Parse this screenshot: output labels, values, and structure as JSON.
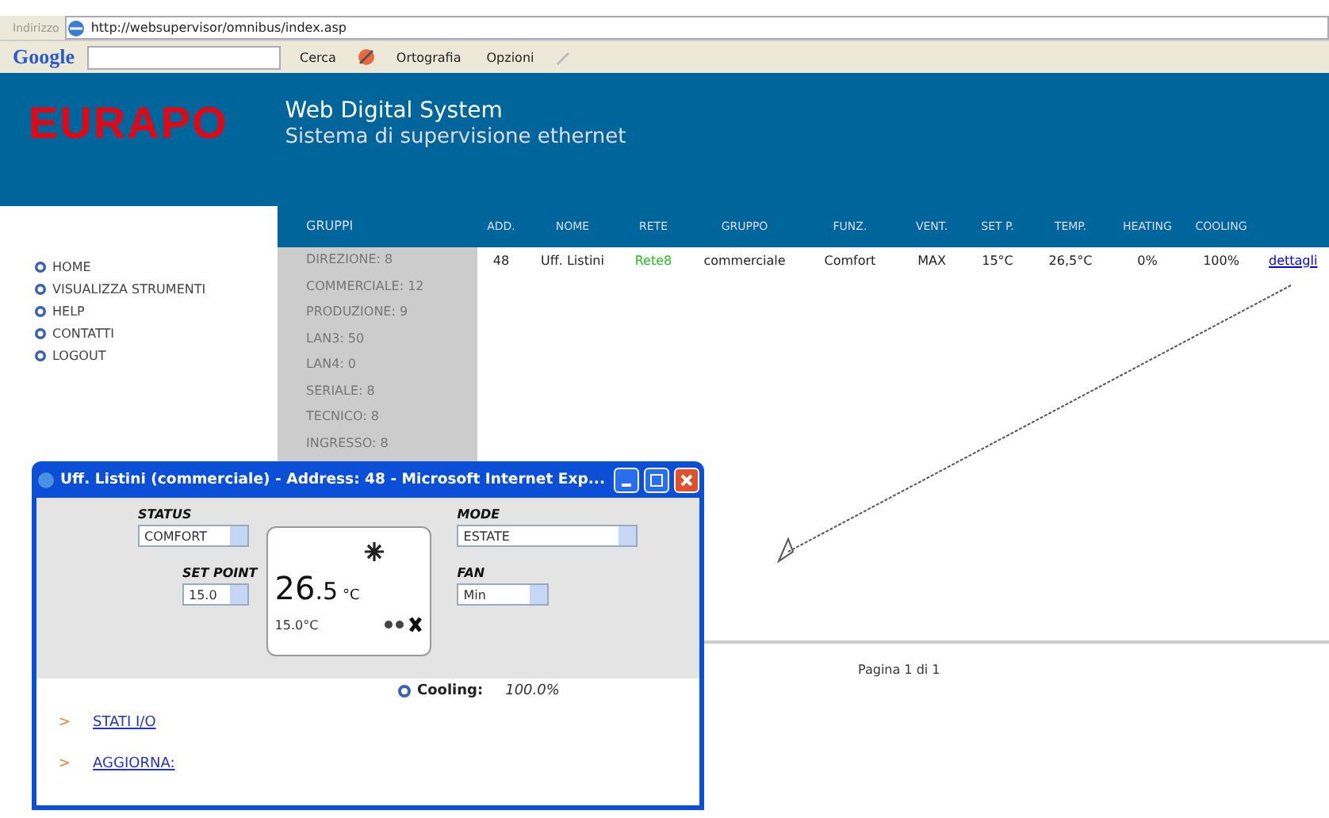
{
  "browser": {
    "address_label": "Indirizzo",
    "url": "http://websupervisor/omnibus/index.asp",
    "google": "Google",
    "search_button": "Cerca",
    "spell_button": "Ortografia",
    "options_button": "Opzioni"
  },
  "header": {
    "logo": "EURAPO",
    "title": "Web Digital System",
    "subtitle": "Sistema di supervisione ethernet"
  },
  "nav": [
    "HOME",
    "VISUALIZZA STRUMENTI",
    "HELP",
    "CONTATTI",
    "LOGOUT"
  ],
  "groups": {
    "heading": "GRUPPI",
    "items": [
      "DIREZIONE: 8",
      "COMMERCIALE: 12",
      "PRODUZIONE: 9",
      "LAN3: 50",
      "LAN4: 0",
      "SERIALE: 8",
      "TECNICO: 8",
      "INGRESSO: 8"
    ]
  },
  "table": {
    "columns": [
      "ADD.",
      "NOME",
      "RETE",
      "GRUPPO",
      "FUNZ.",
      "VENT.",
      "SET P.",
      "TEMP.",
      "HEATING",
      "COOLING"
    ],
    "rows": [
      {
        "add": "48",
        "nome": "Uff. Listini",
        "rete": "Rete8",
        "gruppo": "commerciale",
        "funz": "Comfort",
        "vent": "MAX",
        "setp": "15°C",
        "temp": "26,5°C",
        "heating": "0%",
        "cooling": "100%",
        "link": "dettagli"
      }
    ]
  },
  "pagination": "Pagina 1 di 1",
  "popup": {
    "title": "Uff. Listini (commerciale) - Address: 48 - Microsoft Internet Exp...",
    "status": {
      "label": "STATUS",
      "value": "COMFORT"
    },
    "mode": {
      "label": "MODE",
      "value": "ESTATE"
    },
    "set_point": {
      "label": "SET POINT",
      "value": "15.0"
    },
    "fan": {
      "label": "FAN",
      "value": "Min"
    },
    "display": {
      "temp_int": "26",
      "temp_dec": ".5",
      "unit": "°C",
      "setpoint": "15.0°C"
    },
    "cooling": {
      "label": "Cooling:",
      "value": "100.0%"
    },
    "links": [
      {
        "marker": ">",
        "label": "STATI I/O"
      },
      {
        "marker": ">",
        "label": "AGGIORNA:"
      }
    ]
  }
}
